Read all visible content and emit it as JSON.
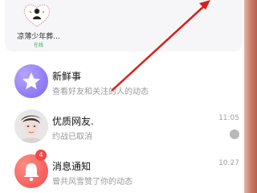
{
  "friend_panel": {
    "name": "凉薄少年葬...",
    "status": "在线"
  },
  "conversations": [
    {
      "title": "新鲜事",
      "subtitle": "查看好友和关注的人的动态",
      "time": "",
      "icon": "star-icon"
    },
    {
      "title": "优质网友.",
      "subtitle": "约战已取消",
      "time": "11:05",
      "icon": "user-avatar"
    },
    {
      "title": "消息通知",
      "subtitle": "曾共风雪赞了你的动态",
      "time": "10:27",
      "badge": "4",
      "icon": "bell-icon"
    }
  ],
  "colors": {
    "accent_purple": "#8f7bf2",
    "notify_red": "#f05a5a",
    "online_green": "#2fb36a",
    "arrow_red": "#d8201c"
  }
}
